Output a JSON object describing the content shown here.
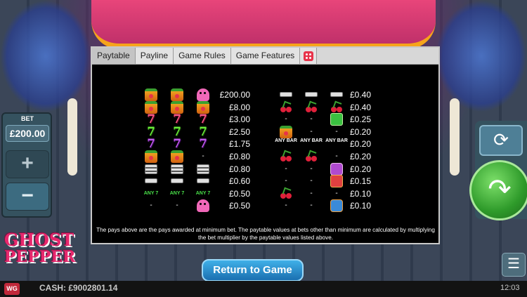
{
  "tabs": [
    "Paytable",
    "Payline",
    "Game Rules",
    "Game Features"
  ],
  "active_tab": "Paytable",
  "bet": {
    "label": "BET",
    "value": "£200.00",
    "plus": "+",
    "minus": "−"
  },
  "logo": {
    "line1": "GHOST",
    "line2": "PEPPER"
  },
  "paytable_left": [
    {
      "symbols": [
        "pepper",
        "pepper",
        "skull"
      ],
      "pay": "£200.00"
    },
    {
      "symbols": [
        "pepper",
        "pepper",
        "pepper"
      ],
      "pay": "£8.00"
    },
    {
      "symbols": [
        "red7",
        "red7",
        "red7"
      ],
      "pay": "£3.00"
    },
    {
      "symbols": [
        "green7",
        "green7",
        "green7"
      ],
      "pay": "£2.50"
    },
    {
      "symbols": [
        "purple7",
        "purple7",
        "purple7"
      ],
      "pay": "£1.75"
    },
    {
      "symbols": [
        "pepper",
        "pepper",
        "-"
      ],
      "pay": "£0.80"
    },
    {
      "symbols": [
        "bar3",
        "bar3",
        "bar3"
      ],
      "pay": "£0.80"
    },
    {
      "symbols": [
        "bar1",
        "bar1",
        "bar1"
      ],
      "pay": "£0.60"
    },
    {
      "symbols": [
        "ANY 7",
        "ANY 7",
        "ANY 7"
      ],
      "pay": "£0.50"
    },
    {
      "symbols": [
        "-",
        "-",
        "skull"
      ],
      "pay": "£0.50"
    }
  ],
  "paytable_right": [
    {
      "symbols": [
        "bar1",
        "bar1",
        "bar1"
      ],
      "pay": "£0.40"
    },
    {
      "symbols": [
        "cherry",
        "cherry",
        "cherry"
      ],
      "pay": "£0.40"
    },
    {
      "symbols": [
        "-",
        "-",
        "green"
      ],
      "pay": "£0.25"
    },
    {
      "symbols": [
        "pepper",
        "-",
        "-"
      ],
      "pay": "£0.20"
    },
    {
      "symbols": [
        "ANY BAR",
        "ANY BAR",
        "ANY BAR"
      ],
      "pay": "£0.20"
    },
    {
      "symbols": [
        "cherry",
        "cherry",
        "-"
      ],
      "pay": "£0.20"
    },
    {
      "symbols": [
        "-",
        "-",
        "violet"
      ],
      "pay": "£0.20"
    },
    {
      "symbols": [
        "-",
        "-",
        "redbox"
      ],
      "pay": "£0.15"
    },
    {
      "symbols": [
        "cherry",
        "-",
        "-"
      ],
      "pay": "£0.10"
    },
    {
      "symbols": [
        "-",
        "-",
        "blue"
      ],
      "pay": "£0.10"
    }
  ],
  "bar_text": "BAR",
  "note": "The pays above are the pays awarded at minimum bet. The paytable values at bets other than minimum are calculated by multiplying the bet multiplier by the paytable values listed above.",
  "return_button": "Return to Game",
  "footer": {
    "cash": "CASH: £9002801.14",
    "time": "12:03",
    "brand": "WG"
  },
  "controls": {
    "reload_icon": "⟳",
    "spin_icon": "↷",
    "menu_icon": "☰"
  }
}
